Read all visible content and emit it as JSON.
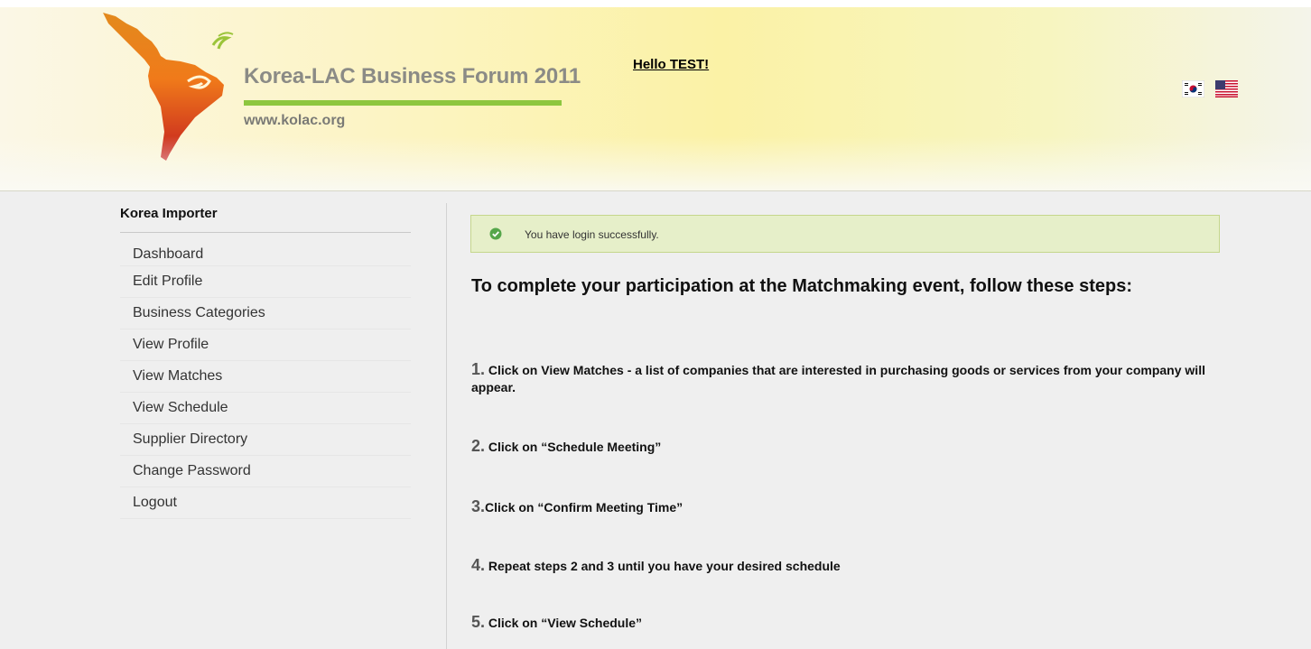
{
  "header": {
    "logo_title": "Korea-LAC Business Forum 2011",
    "logo_url": "www.kolac.org",
    "greeting": "Hello TEST!",
    "flags": [
      "korea-flag-icon",
      "usa-flag-icon"
    ]
  },
  "sidebar": {
    "title": "Korea Importer",
    "items": [
      {
        "label": "Dashboard"
      },
      {
        "label": "Edit Profile"
      },
      {
        "label": "Business Categories"
      },
      {
        "label": "View Profile"
      },
      {
        "label": "View Matches"
      },
      {
        "label": "View Schedule"
      },
      {
        "label": "Supplier Directory"
      },
      {
        "label": "Change Password"
      },
      {
        "label": "Logout"
      }
    ]
  },
  "main": {
    "alert": "You have login successfully.",
    "heading": "To complete your participation at the Matchmaking event, follow these steps:",
    "steps": [
      {
        "num": "1.",
        "text": " Click on View Matches - a list of companies that are interested in purchasing  goods or services from your company will appear."
      },
      {
        "num": "2.",
        "text": " Click on “Schedule Meeting”"
      },
      {
        "num": "3.",
        "text": "Click on “Confirm Meeting Time”"
      },
      {
        "num": "4.",
        "text": " Repeat steps 2 and 3 until you have your desired schedule"
      },
      {
        "num": "5.",
        "text": " Click on “View Schedule”"
      }
    ]
  },
  "colors": {
    "accent_green": "#8dc63f",
    "alert_bg": "#e6efc9",
    "alert_border": "#c5d68c",
    "success_icon": "#55a64a"
  }
}
